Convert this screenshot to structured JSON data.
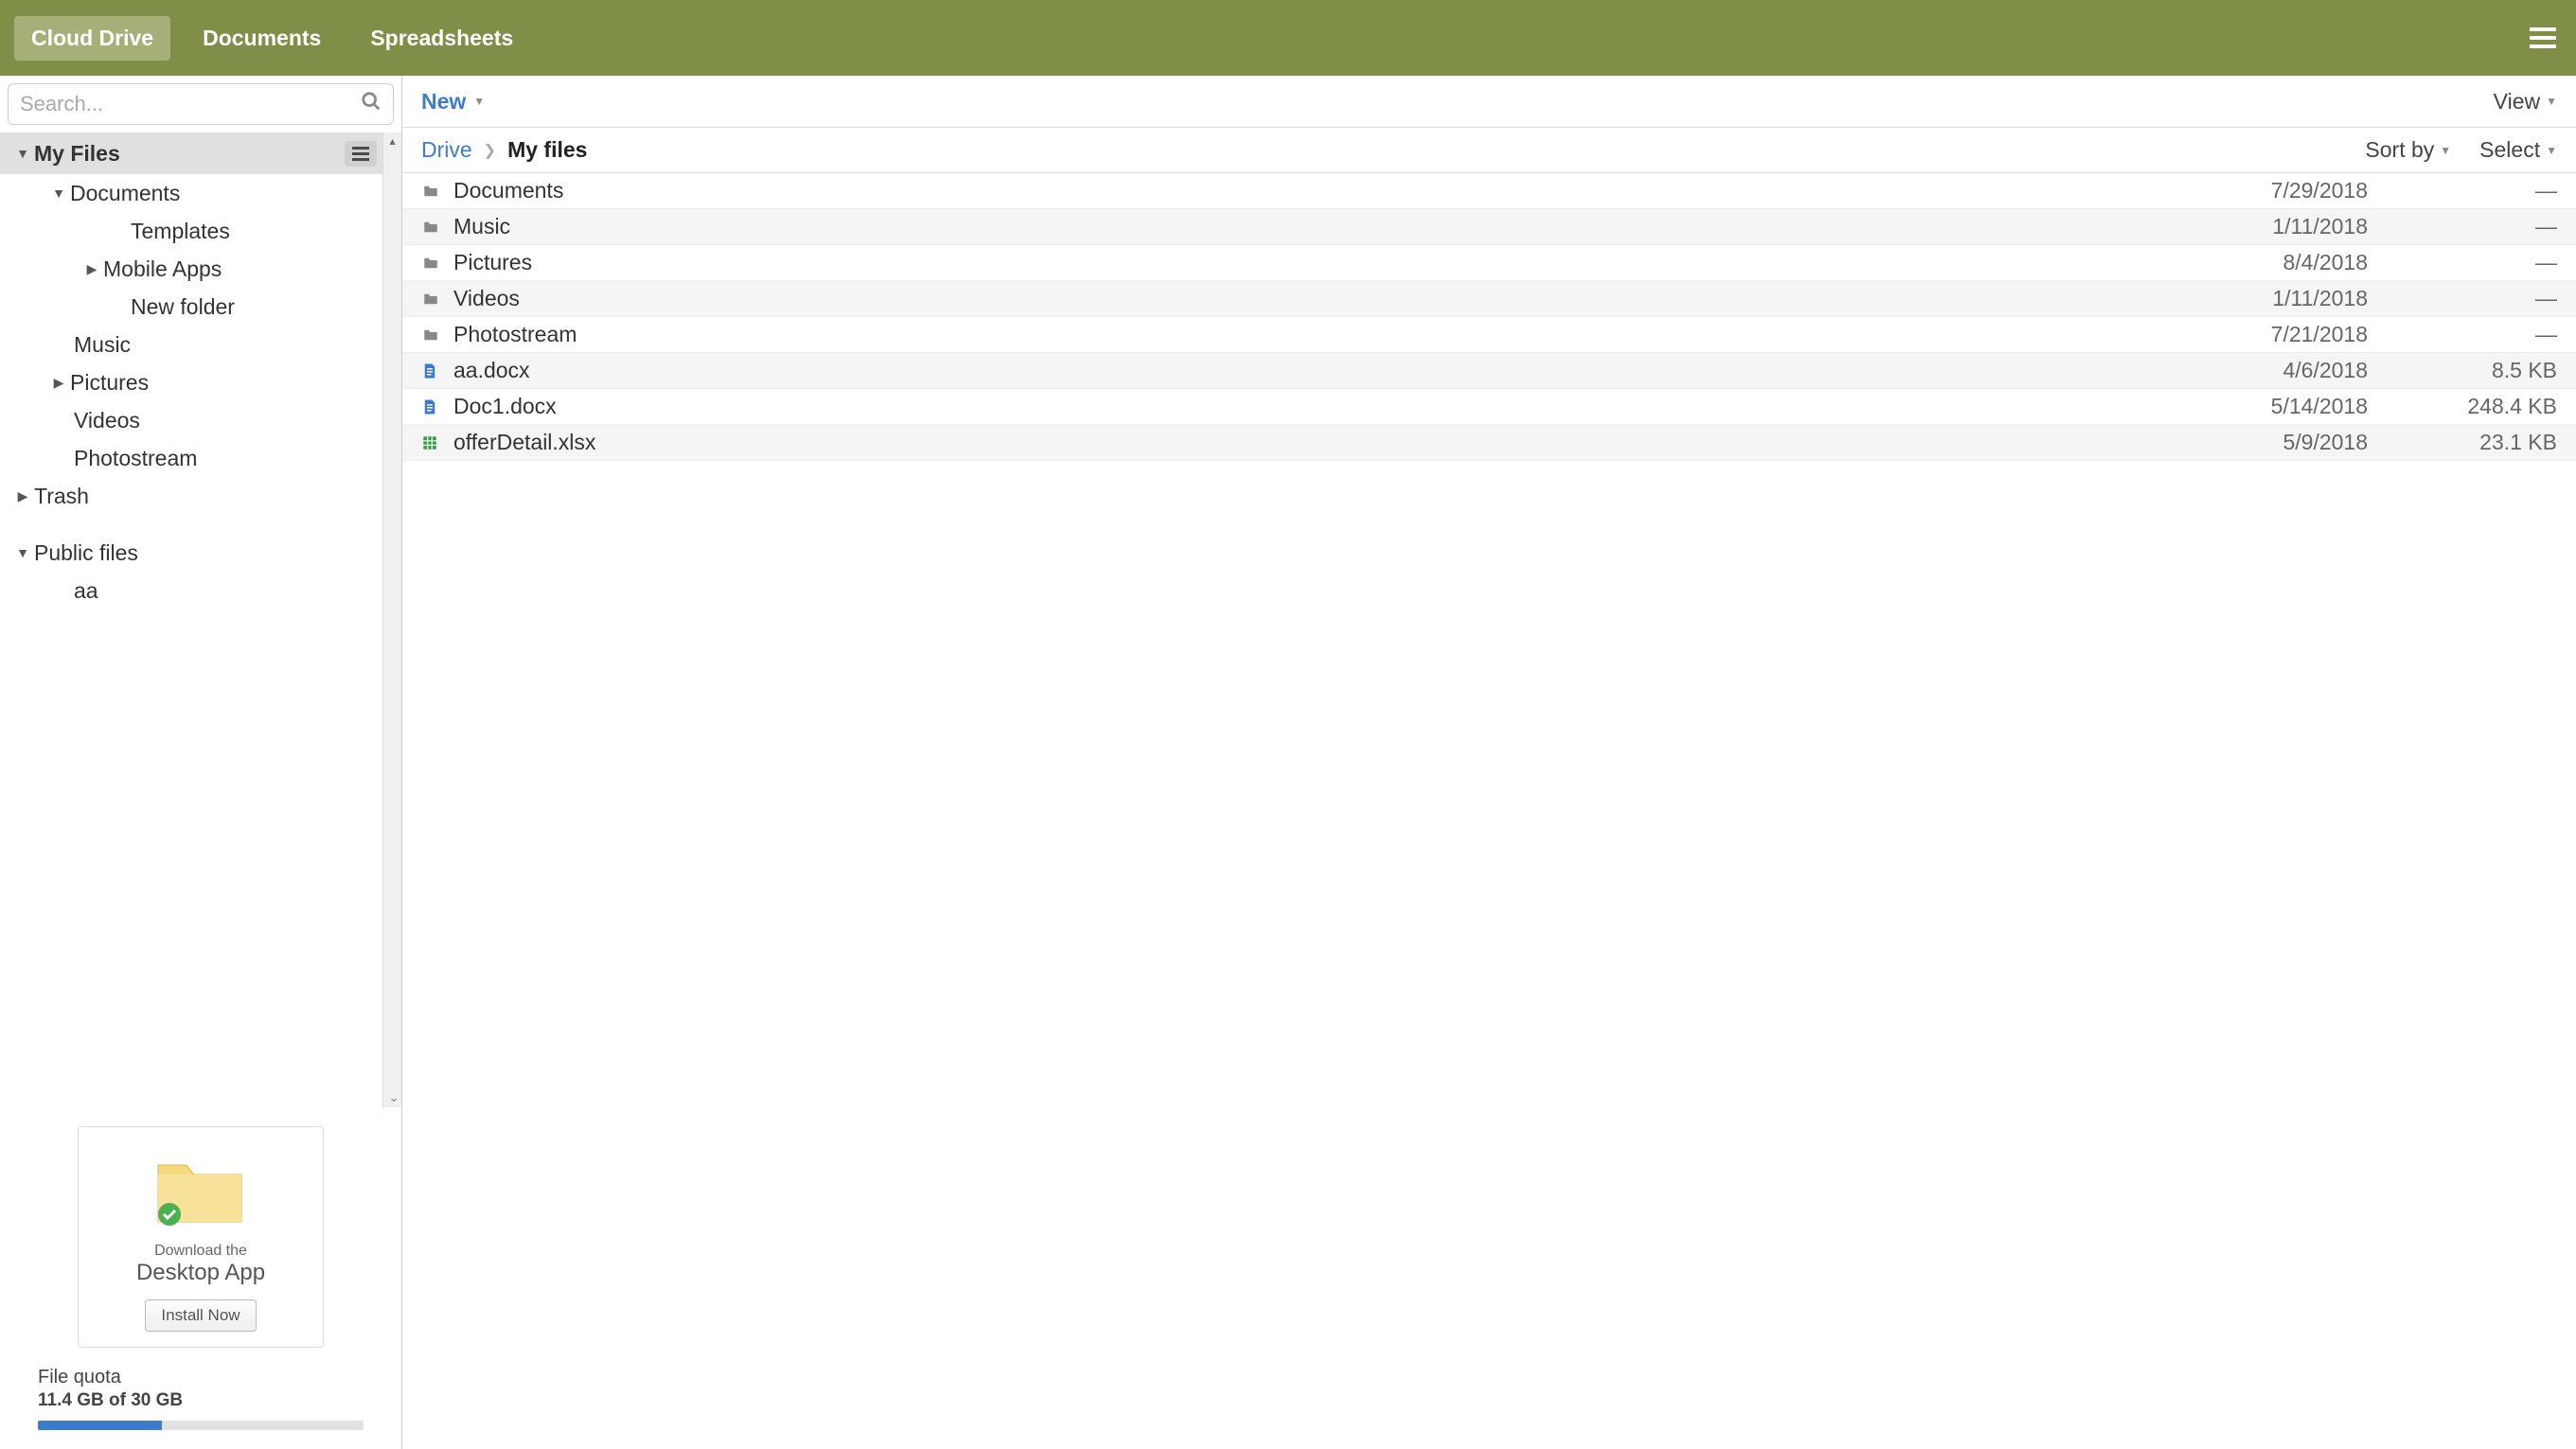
{
  "header": {
    "tabs": [
      {
        "label": "Cloud Drive",
        "active": true
      },
      {
        "label": "Documents",
        "active": false
      },
      {
        "label": "Spreadsheets",
        "active": false
      }
    ]
  },
  "sidebar": {
    "search_placeholder": "Search...",
    "tree": {
      "root": "My Files",
      "documents": "Documents",
      "templates": "Templates",
      "mobile_apps": "Mobile Apps",
      "new_folder": "New folder",
      "music": "Music",
      "pictures": "Pictures",
      "videos": "Videos",
      "photostream": "Photostream",
      "trash": "Trash",
      "public_files": "Public files",
      "aa": "aa"
    },
    "promo": {
      "line1": "Download the",
      "line2": "Desktop App",
      "button": "Install Now"
    },
    "quota": {
      "label": "File quota",
      "used_text": "11.4 GB of 30 GB",
      "percent": 38
    }
  },
  "content": {
    "toolbar": {
      "new": "New",
      "view": "View"
    },
    "breadcrumb": {
      "root": "Drive",
      "current": "My files",
      "sort": "Sort by",
      "select": "Select"
    },
    "files": [
      {
        "type": "folder",
        "name": "Documents",
        "date": "7/29/2018",
        "size": "—"
      },
      {
        "type": "folder",
        "name": "Music",
        "date": "1/11/2018",
        "size": "—"
      },
      {
        "type": "folder",
        "name": "Pictures",
        "date": "8/4/2018",
        "size": "—"
      },
      {
        "type": "folder",
        "name": "Videos",
        "date": "1/11/2018",
        "size": "—"
      },
      {
        "type": "folder",
        "name": "Photostream",
        "date": "7/21/2018",
        "size": "—"
      },
      {
        "type": "doc",
        "name": "aa.docx",
        "date": "4/6/2018",
        "size": "8.5 KB"
      },
      {
        "type": "doc",
        "name": "Doc1.docx",
        "date": "5/14/2018",
        "size": "248.4 KB"
      },
      {
        "type": "sheet",
        "name": "offerDetail.xlsx",
        "date": "5/9/2018",
        "size": "23.1 KB"
      }
    ]
  }
}
